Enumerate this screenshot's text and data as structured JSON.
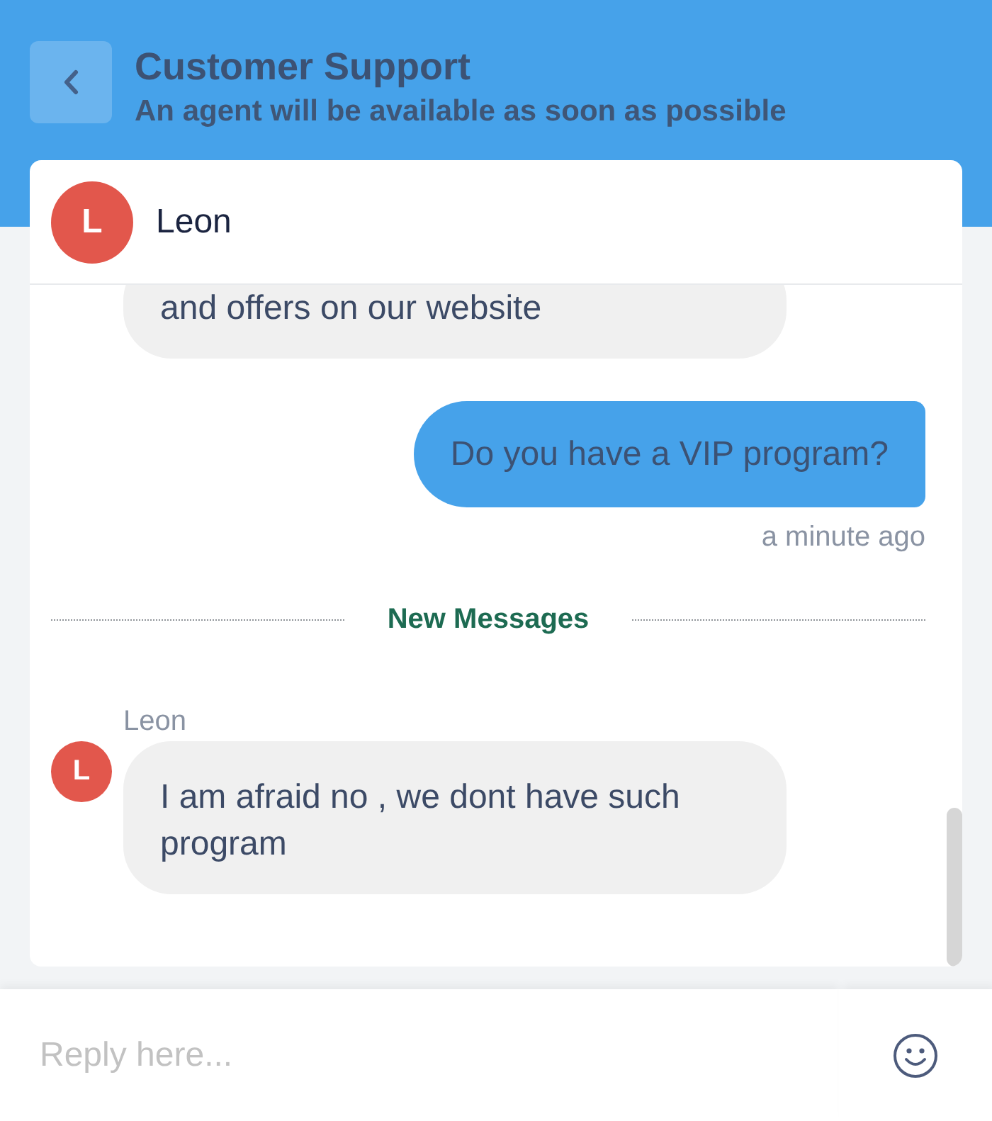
{
  "header": {
    "title": "Customer Support",
    "subtitle": "An agent will be available as soon as possible"
  },
  "agent": {
    "initial": "L",
    "name": "Leon"
  },
  "messages": [
    {
      "kind": "incoming",
      "text": "and offers on our website"
    },
    {
      "kind": "outgoing",
      "text": "Do you have a VIP program?",
      "time": "a minute ago"
    },
    {
      "kind": "divider",
      "label": "New Messages"
    },
    {
      "kind": "incoming",
      "sender": "Leon",
      "avatar": "L",
      "text": "I am afraid no , we dont have such program"
    }
  ],
  "composer": {
    "placeholder": "Reply here..."
  }
}
